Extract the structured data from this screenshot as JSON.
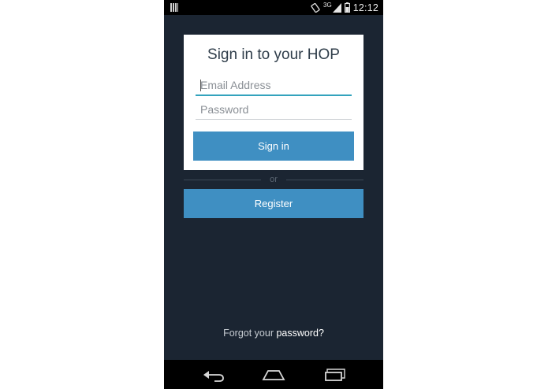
{
  "status_bar": {
    "time": "12:12",
    "network": "3G",
    "icons": [
      "notification-icon",
      "rotation-icon",
      "signal-icon",
      "battery-icon"
    ]
  },
  "login": {
    "title": "Sign in to your HOP",
    "email_placeholder": "Email Address",
    "email_value": "",
    "password_placeholder": "Password",
    "password_value": "",
    "signin_label": "Sign in"
  },
  "divider_text": "or",
  "register_label": "Register",
  "forgot": {
    "prefix": "Forgot your ",
    "link": "password?"
  },
  "nav": {
    "icons": [
      "back-icon",
      "home-icon",
      "recent-apps-icon"
    ]
  },
  "colors": {
    "background": "#1b2532",
    "button": "#3f8fc2",
    "field_active_underline": "#33a3bd",
    "card": "#ffffff"
  }
}
